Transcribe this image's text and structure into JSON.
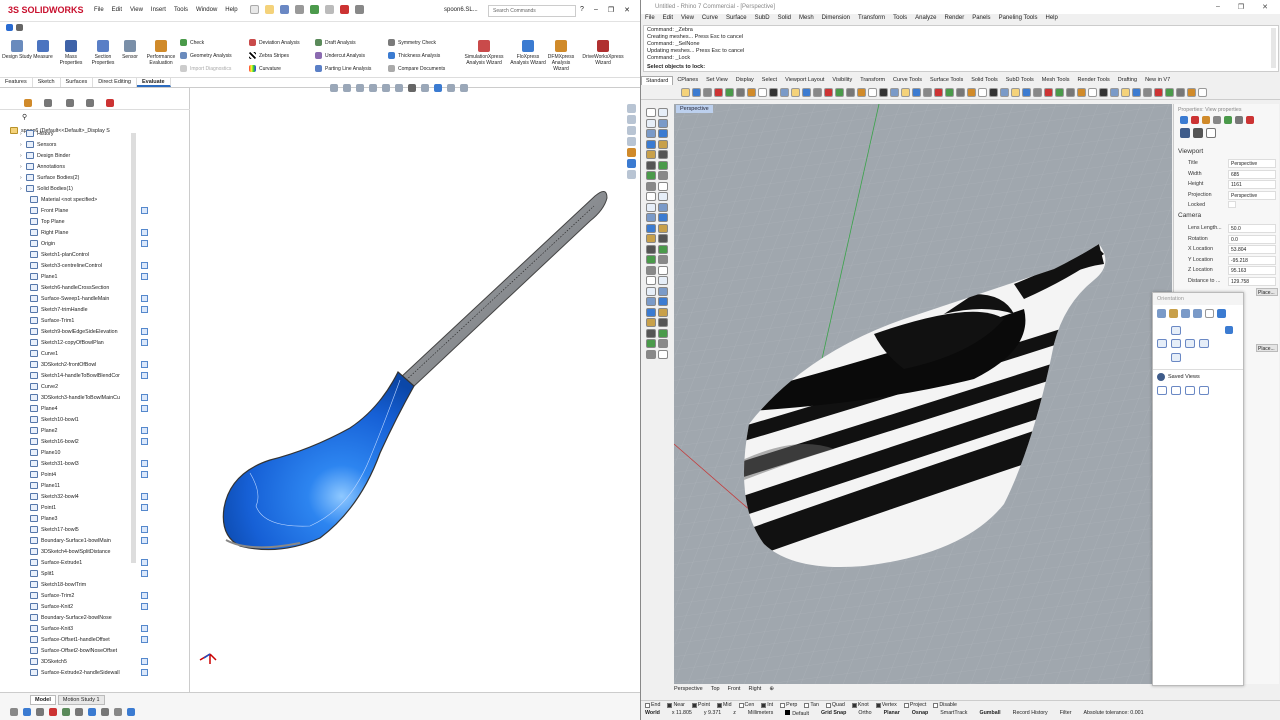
{
  "solidworks": {
    "logo": "3S SOLIDWORKS",
    "menu": [
      "File",
      "Edit",
      "View",
      "Insert",
      "Tools",
      "Window",
      "Help"
    ],
    "doc_name": "spoon6.SL...",
    "search_placeholder": "Search Commands",
    "ribbon_big": [
      "Design Study",
      "Measure",
      "Mass Properties",
      "Section Properties",
      "Sensor",
      "Performance Evaluation"
    ],
    "ribbon_col1": [
      "Check",
      "Geometry Analysis",
      "Import Diagnostics"
    ],
    "ribbon_col2": [
      "Deviation Analysis",
      "Zebra Stripes",
      "Curvature"
    ],
    "ribbon_col3": [
      "Draft Analysis",
      "Undercut Analysis",
      "Parting Line Analysis"
    ],
    "ribbon_col4": [
      "Symmetry Check",
      "Thickness Analysis",
      "Compare Documents"
    ],
    "ribbon_big2": [
      "SimulationXpress Analysis Wizard",
      "FloXpress Analysis Wizard",
      "DFMXpress Analysis Wizard",
      "DriveWorksXpress Wizard"
    ],
    "tabs": [
      "Features",
      "Sketch",
      "Surfaces",
      "Direct Editing",
      "Evaluate"
    ],
    "active_tab": "Evaluate",
    "tree_root": "spoon6 (Default<<Default>_Display S",
    "tree": [
      "History",
      "Sensors",
      "Design Binder",
      "Annotations",
      "Surface Bodies(2)",
      "Solid Bodies(1)",
      "Material <not specified>",
      "Front Plane",
      "Top Plane",
      "Right Plane",
      "Origin",
      "Sketch1-planControl",
      "Sketch3-centrelineControl",
      "Plane1",
      "Sketch6-handleCrossSection",
      "Surface-Sweep1-handleMain",
      "Sketch7-trimHandle",
      "Surface-Trim1",
      "Sketch9-bowlEdgeSideElevation",
      "Sketch12-copyOfBowlPlan",
      "Curve1",
      "3DSketch2-frontOfBowl",
      "Sketch14-handleToBowlBlendCor",
      "Curve2",
      "3DSketch3-handleToBowlMainCu",
      "Plane4",
      "Sketch10-bowl1",
      "Plane2",
      "Sketch16-bowl2",
      "Plane10",
      "Sketch31-bowl3",
      "Point4",
      "Plane11",
      "Sketch32-bowl4",
      "Point1",
      "Plane3",
      "Sketch17-bowl5",
      "Boundary-Surface1-bowlMain",
      "3DSketch4-bowlSplitDistance",
      "Surface-Extrude1",
      "Split1",
      "Sketch18-bowlTrim",
      "Surface-Trim2",
      "Surface-Knit2",
      "Boundary-Surface2-bowlNose",
      "Surface-Knit3",
      "Surface-Offset1-handleOffset",
      "Surface-Offset2-bowlNoseOffset",
      "3DSketch5",
      "Surface-Extrude2-handleSidewall"
    ],
    "bottom_tabs": [
      "Model",
      "Motion Study 1"
    ],
    "active_bottom_tab": "Model",
    "spoon_colors": {
      "handle": "#8a8d91",
      "bowl": "#1e6be0"
    }
  },
  "rhino": {
    "title": "Untitled - Rhino 7 Commercial - [Perspective]",
    "menu": [
      "File",
      "Edit",
      "View",
      "Curve",
      "Surface",
      "SubD",
      "Solid",
      "Mesh",
      "Dimension",
      "Transform",
      "Tools",
      "Analyze",
      "Render",
      "Panels",
      "Paneling Tools",
      "Help"
    ],
    "command_history": [
      "Command: _Zebra",
      "Creating meshes... Press Esc to cancel",
      "Command: _SelNone",
      "Updating meshes... Press Esc to cancel",
      "Command: _Lock"
    ],
    "command_prompt": "Select objects to lock:",
    "tabs": [
      "Standard",
      "CPlanes",
      "Set View",
      "Display",
      "Select",
      "Viewport Layout",
      "Visibility",
      "Transform",
      "Curve Tools",
      "Surface Tools",
      "Solid Tools",
      "SubD Tools",
      "Mesh Tools",
      "Render Tools",
      "Drafting",
      "New in V7"
    ],
    "viewport_label": "Perspective",
    "properties": {
      "header": "Properties: View properties",
      "viewport_section": "Viewport",
      "rows": [
        {
          "label": "Title",
          "value": "Perspective"
        },
        {
          "label": "Width",
          "value": "685"
        },
        {
          "label": "Height",
          "value": "1161"
        },
        {
          "label": "Projection",
          "value": "Perspective"
        },
        {
          "label": "Locked",
          "value": ""
        }
      ],
      "camera_section": "Camera",
      "camera_rows": [
        {
          "label": "Lens Length...",
          "value": "50.0"
        },
        {
          "label": "Rotation",
          "value": "0.0"
        },
        {
          "label": "X Location",
          "value": "53.804"
        },
        {
          "label": "Y Location",
          "value": "-95.218"
        },
        {
          "label": "Z Location",
          "value": "95.163"
        },
        {
          "label": "Distance to ...",
          "value": "129.758"
        }
      ],
      "place_buttons": [
        "Place...",
        "Place..."
      ]
    },
    "orientation_panel": {
      "title": "Orientation",
      "saved_views": "Saved Views"
    },
    "viewport_tabs": [
      "Perspective",
      "Top",
      "Front",
      "Right"
    ],
    "osnaps": [
      "End",
      "Near",
      "Point",
      "Mid",
      "Cen",
      "Int",
      "Perp",
      "Tan",
      "Quad",
      "Knot",
      "Vertex",
      "Project",
      "Disable"
    ],
    "status": {
      "cplane": "World",
      "x": "x 11.805",
      "y": "y 9.371",
      "z": "z",
      "units": "Millimeters",
      "layer": "Default",
      "toggles": [
        "Grid Snap",
        "Ortho",
        "Planar",
        "Osnap",
        "SmartTrack",
        "Gumball",
        "Record History",
        "Filter"
      ],
      "tolerance": "Absolute tolerance: 0.001"
    }
  }
}
